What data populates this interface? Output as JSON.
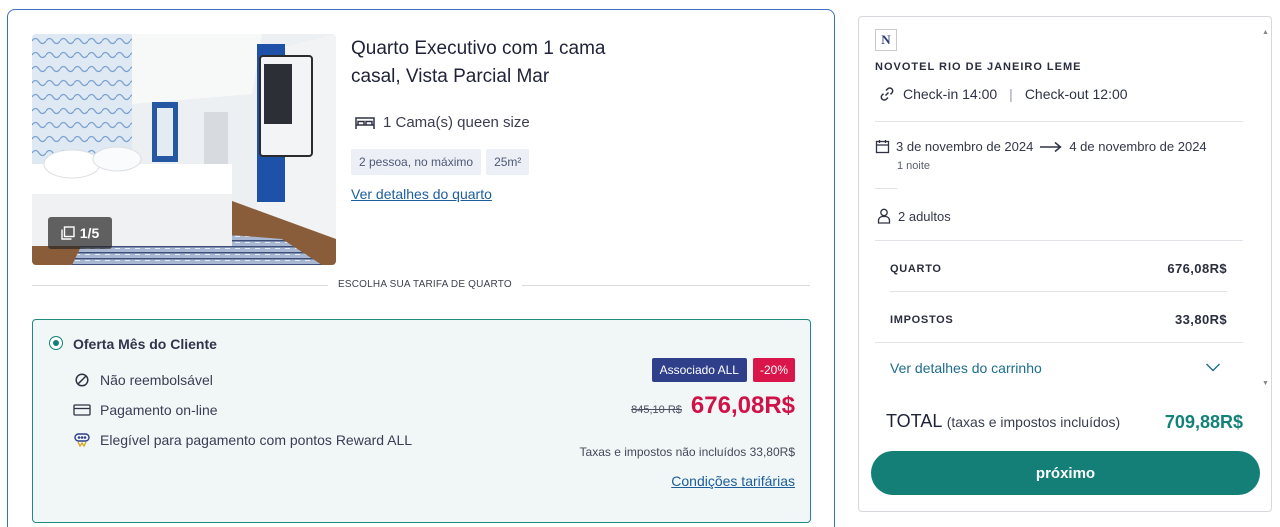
{
  "room": {
    "title": "Quarto Executivo com 1 cama casal, Vista Parcial Mar",
    "photo_counter": "1/5",
    "bed": "1 Cama(s) queen size",
    "tags": [
      "2 pessoa, no máximo",
      "25m²"
    ],
    "details_link": "Ver detalhes do quarto",
    "rate_divider": "ESCOLHA SUA TARIFA DE QUARTO"
  },
  "offer": {
    "name": "Oferta Mês do Cliente",
    "features": [
      {
        "icon": "no-refund-icon",
        "label": "Não reembolsável"
      },
      {
        "icon": "credit-card-icon",
        "label": "Pagamento on-line"
      },
      {
        "icon": "reward-points-icon",
        "label": "Elegível para pagamento com pontos Reward ALL"
      }
    ],
    "member_badge": "Associado ALL",
    "discount_badge": "-20%",
    "old_price": "845,10 R$",
    "new_price": "676,08R$",
    "tax_note": "Taxas e impostos não incluídos 33,80R$",
    "conditions_link": "Condições tarifárias"
  },
  "summary": {
    "logo_letter": "N",
    "hotel_name": "NOVOTEL RIO DE JANEIRO LEME",
    "checkin": "Check-in 14:00",
    "checkout": "Check-out 12:00",
    "date_from": "3 de novembro de 2024",
    "date_to": "4 de novembro de 2024",
    "nights": "1 noite",
    "guests": "2 adultos",
    "room_label": "QUARTO",
    "room_value": "676,08R$",
    "tax_label": "IMPOSTOS",
    "tax_value": "33,80R$",
    "cart_link": "Ver detalhes do carrinho",
    "total_label": "TOTAL",
    "total_note": "(taxas e impostos incluídos)",
    "total_value": "709,88R$",
    "next_button": "próximo"
  },
  "colors": {
    "accent": "#137f77",
    "price": "#cf1248",
    "member_badge": "#2f3f8a",
    "card_border": "#3b6fc4"
  }
}
